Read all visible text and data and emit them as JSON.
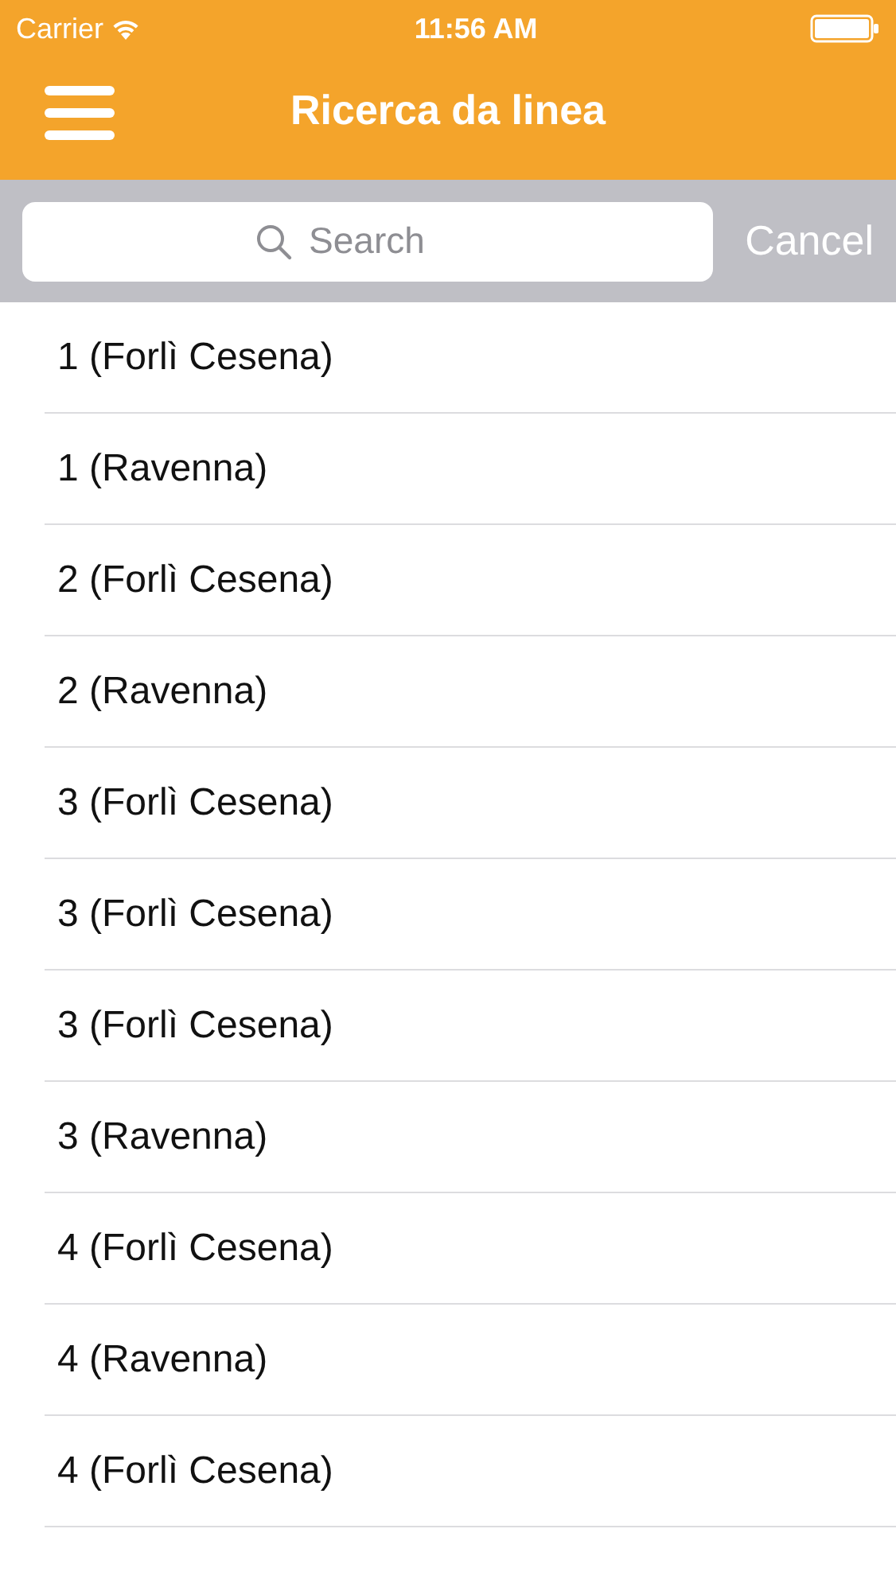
{
  "status_bar": {
    "carrier": "Carrier",
    "time": "11:56 AM"
  },
  "nav_bar": {
    "title": "Ricerca da linea"
  },
  "search": {
    "placeholder": "Search",
    "cancel": "Cancel",
    "cancel_disabled": true
  },
  "rows": [
    {
      "label": "1 (Forlì Cesena)"
    },
    {
      "label": "1 (Ravenna)"
    },
    {
      "label": "2 (Forlì Cesena)"
    },
    {
      "label": "2 (Ravenna)"
    },
    {
      "label": "3 (Forlì Cesena)"
    },
    {
      "label": "3 (Forlì Cesena)"
    },
    {
      "label": "3 (Forlì Cesena)"
    },
    {
      "label": "3 (Ravenna)"
    },
    {
      "label": "4 (Forlì Cesena)"
    },
    {
      "label": "4 (Ravenna)"
    },
    {
      "label": "4 (Forlì Cesena)"
    }
  ]
}
